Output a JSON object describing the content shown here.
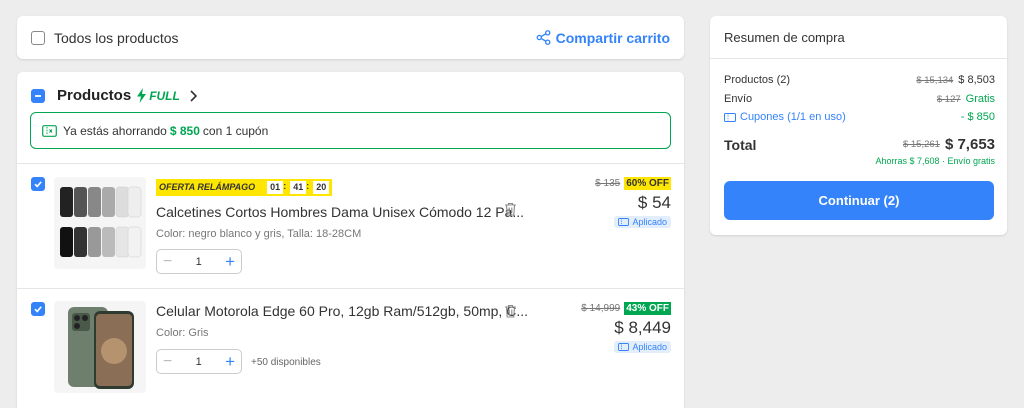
{
  "topbar": {
    "all_products_label": "Todos los productos",
    "share_label": "Compartir carrito"
  },
  "products_section": {
    "title": "Productos",
    "full_badge": "FULL",
    "savings_prefix": "Ya estás ahorrando",
    "savings_amount": "$ 850",
    "savings_suffix": "con 1 cupón"
  },
  "items": [
    {
      "flash_label": "OFERTA RELÁMPAGO",
      "timer": [
        "01",
        "41",
        "20"
      ],
      "title": "Calcetines Cortos Hombres Dama Unisex Cómodo 12 Pa...",
      "meta": "Color: negro blanco y gris, Talla: 18-28CM",
      "quantity": "1",
      "old_price": "$ 135",
      "discount": "60% OFF",
      "price": "$ 54",
      "applied": "Aplicado"
    },
    {
      "title": "Celular Motorola Edge 60 Pro, 12gb Ram/512gb, 50mp, C...",
      "meta": "Color: Gris",
      "quantity": "1",
      "availability": "+50 disponibles",
      "old_price": "$ 14,999",
      "discount": "43% OFF",
      "price": "$ 8,449",
      "applied": "Aplicado"
    }
  ],
  "summary": {
    "title": "Resumen de compra",
    "products_label": "Productos (2)",
    "products_old": "$ 15,134",
    "products_price": "$ 8,503",
    "shipping_label": "Envío",
    "shipping_old": "$ 127",
    "shipping_value": "Gratis",
    "coupons_label": "Cupones (1/1 en uso)",
    "coupons_value": "- $ 850",
    "total_label": "Total",
    "total_old": "$ 15,261",
    "total_price": "$ 7,653",
    "savings_line": "Ahorras $ 7,608 · Envío gratis",
    "continue_label": "Continuar (2)"
  },
  "colors": {
    "accent": "#3483fa",
    "green": "#00a650",
    "yellow": "#ffe600",
    "background": "#ededed"
  }
}
